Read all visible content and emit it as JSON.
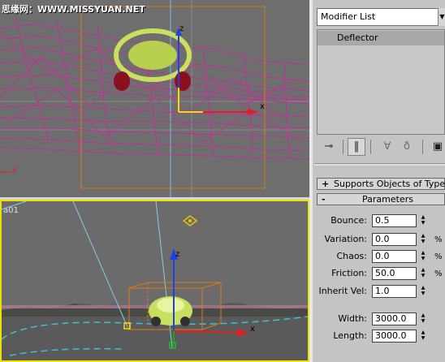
{
  "watermark": "思缘网：WWW.MISSYUAN.NET",
  "viewport_persp_label": "a01",
  "axis_labels": {
    "z": "z",
    "x": "x"
  },
  "modifier_list": {
    "label": "Modifier List"
  },
  "stack": {
    "item": "Deflector"
  },
  "toolbar_icons": [
    "pin-stack-icon",
    "show-end-result-icon",
    "make-unique-icon",
    "remove-modifier-icon",
    "configure-sets-icon"
  ],
  "rollouts": [
    {
      "sign": "+",
      "title": "Supports Objects of Type"
    },
    {
      "sign": "-",
      "title": "Parameters"
    }
  ],
  "params": [
    {
      "label": "Bounce:",
      "value": "0.5",
      "unit": ""
    },
    {
      "label": "Variation:",
      "value": "0.0",
      "unit": "%"
    },
    {
      "label": "Chaos:",
      "value": "0.0",
      "unit": "%"
    },
    {
      "label": "Friction:",
      "value": "50.0",
      "unit": "%"
    },
    {
      "label": "Inherit Vel:",
      "value": "1.0",
      "unit": ""
    },
    {
      "label": "Width:",
      "value": "3000.0",
      "unit": ""
    },
    {
      "label": "Length:",
      "value": "3000.0",
      "unit": ""
    }
  ],
  "colors": {
    "wireframe": "#c0309c",
    "gizmo": "#e07a14",
    "car": "#c8e060",
    "viewport_bg": "#6e6e6e",
    "active_border": "#f0e000"
  }
}
